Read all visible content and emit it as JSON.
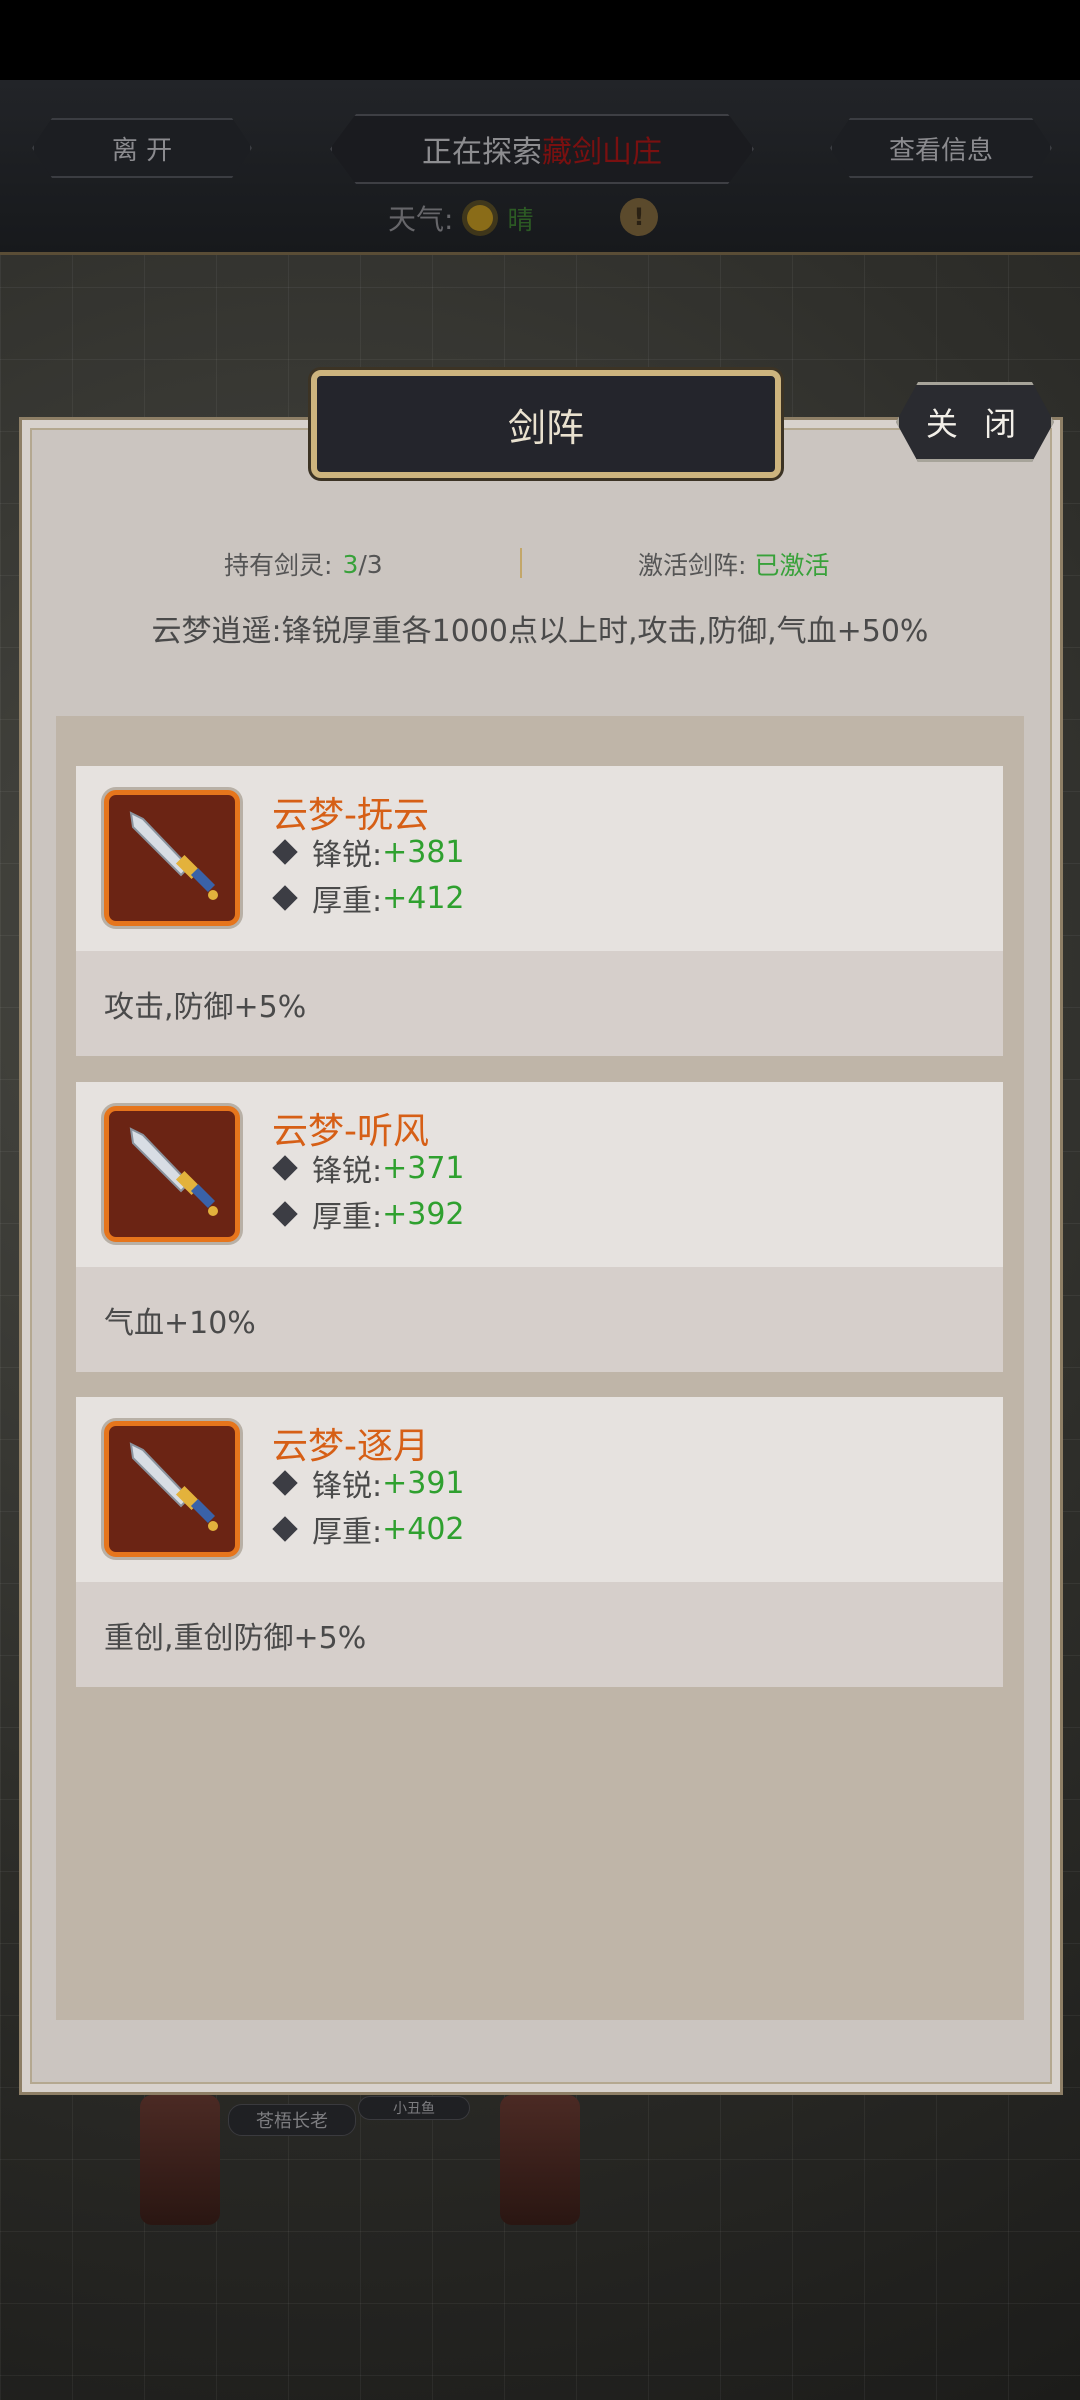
{
  "top_bar": {
    "leave_label": "离 开",
    "exploring_prefix": "正在探索",
    "exploring_location": "藏剑山庄",
    "view_info_label": "查看信息",
    "weather_label": "天气:",
    "weather_value": "晴"
  },
  "background_labels": {
    "npc1": "苍梧长老",
    "npc2": "小丑鱼"
  },
  "dialog": {
    "title": "剑阵",
    "close_label": "关 闭",
    "held_label": "持有剑灵:",
    "held_count": "3",
    "held_total": "/3",
    "activate_label": "激活剑阵:",
    "activate_status": "已激活",
    "bonus_text": "云梦逍遥:锋锐厚重各1000点以上时,攻击,防御,气血+50%",
    "spirits": [
      {
        "name": "云梦-抚云",
        "attr1_label": "锋锐:",
        "attr1_value": "+381",
        "attr2_label": "厚重:",
        "attr2_value": "+412",
        "effect": "攻击,防御+5%"
      },
      {
        "name": "云梦-听风",
        "attr1_label": "锋锐:",
        "attr1_value": "+371",
        "attr2_label": "厚重:",
        "attr2_value": "+392",
        "effect": "气血+10%"
      },
      {
        "name": "云梦-逐月",
        "attr1_label": "锋锐:",
        "attr1_value": "+391",
        "attr2_label": "厚重:",
        "attr2_value": "+402",
        "effect": "重创,重创防御+5%"
      }
    ]
  },
  "colors": {
    "accent_green": "#38a13a",
    "name_orange": "#d65f16",
    "location_red": "#7a1010"
  }
}
